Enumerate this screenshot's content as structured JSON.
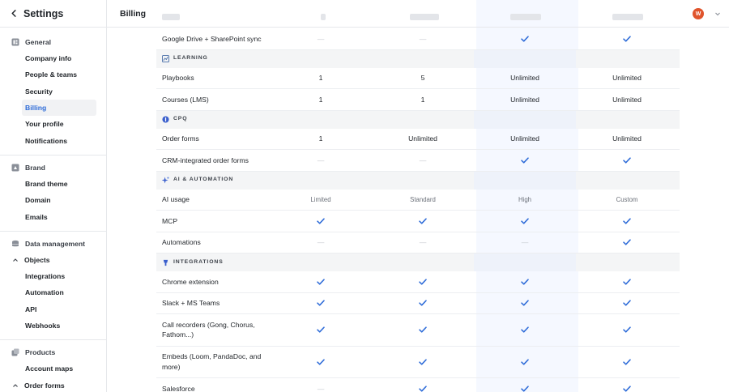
{
  "sidebar": {
    "title": "Settings",
    "general": {
      "heading": "General",
      "items": [
        "Company info",
        "People & teams",
        "Security",
        "Billing",
        "Your profile",
        "Notifications"
      ]
    },
    "brand": {
      "heading": "Brand",
      "items": [
        "Brand theme",
        "Domain",
        "Emails"
      ]
    },
    "data": {
      "heading": "Data management",
      "objects": "Objects",
      "items": [
        "Integrations",
        "Automation",
        "API",
        "Webhooks"
      ]
    },
    "products": {
      "heading": "Products",
      "items": [
        "Account maps",
        "Order forms"
      ]
    }
  },
  "topbar": {
    "title": "Billing",
    "avatar_initials": "W"
  },
  "table": {
    "rows": [
      {
        "kind": "row",
        "label": "Google Drive + SharePoint sync",
        "cells": [
          "—",
          "—",
          "check",
          "check"
        ]
      },
      {
        "kind": "cat",
        "label": "LEARNING",
        "icon": "learning-icon"
      },
      {
        "kind": "row",
        "label": "Playbooks",
        "cells": [
          "1",
          "5",
          "Unlimited",
          "Unlimited"
        ]
      },
      {
        "kind": "row",
        "label": "Courses (LMS)",
        "cells": [
          "1",
          "1",
          "Unlimited",
          "Unlimited"
        ]
      },
      {
        "kind": "cat",
        "label": "CPQ",
        "icon": "cpq-icon"
      },
      {
        "kind": "row",
        "label": "Order forms",
        "cells": [
          "1",
          "Unlimited",
          "Unlimited",
          "Unlimited"
        ]
      },
      {
        "kind": "row",
        "label": "CRM-integrated order forms",
        "cells": [
          "—",
          "—",
          "check",
          "check"
        ]
      },
      {
        "kind": "cat",
        "label": "AI & AUTOMATION",
        "icon": "sparkle-icon"
      },
      {
        "kind": "row",
        "label": "AI usage",
        "cells": [
          "Limited",
          "Standard",
          "High",
          "Custom"
        ],
        "muted": true
      },
      {
        "kind": "row",
        "label": "MCP",
        "cells": [
          "check",
          "check",
          "check",
          "check"
        ]
      },
      {
        "kind": "row",
        "label": "Automations",
        "cells": [
          "—",
          "—",
          "—",
          "check"
        ]
      },
      {
        "kind": "cat",
        "label": "INTEGRATIONS",
        "icon": "plug-icon"
      },
      {
        "kind": "row",
        "label": "Chrome extension",
        "cells": [
          "check",
          "check",
          "check",
          "check"
        ]
      },
      {
        "kind": "row",
        "label": "Slack + MS Teams",
        "cells": [
          "check",
          "check",
          "check",
          "check"
        ]
      },
      {
        "kind": "row",
        "label": "Call recorders (Gong, Chorus, Fathom...)",
        "cells": [
          "check",
          "check",
          "check",
          "check"
        ]
      },
      {
        "kind": "row",
        "label": "Embeds (Loom, PandaDoc, and more)",
        "cells": [
          "check",
          "check",
          "check",
          "check"
        ]
      },
      {
        "kind": "row",
        "label": "Salesforce",
        "cells": [
          "—",
          "check",
          "check",
          "check"
        ]
      }
    ]
  },
  "colors": {
    "accent": "#2d6bd8",
    "check": "#2d6bd8",
    "highlight_column": "#f5f8ff",
    "category_bg": "#f4f5f6"
  }
}
